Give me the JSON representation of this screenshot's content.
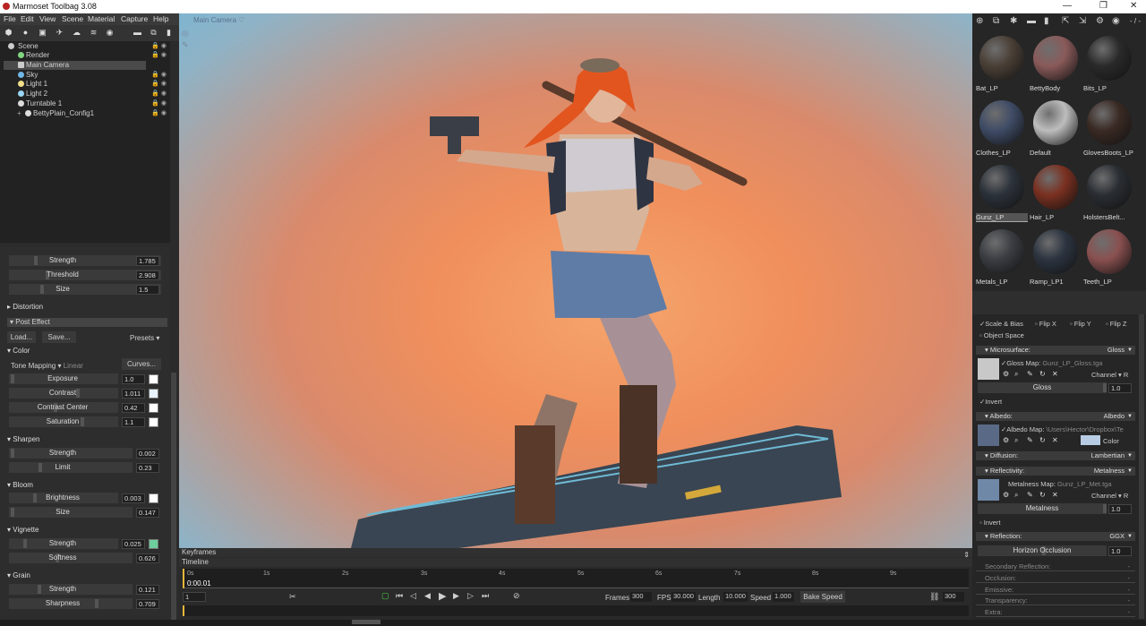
{
  "app": {
    "title": "Marmoset Toolbag 3.08"
  },
  "menu": [
    "File",
    "Edit",
    "View",
    "Scene",
    "Material",
    "Capture",
    "Help"
  ],
  "scene_tree": [
    {
      "label": "Scene",
      "depth": 0,
      "color": "#cccccc"
    },
    {
      "label": "Render",
      "depth": 1,
      "color": "#7fd67f"
    },
    {
      "label": "Main Camera",
      "depth": 1,
      "color": "#cccccc",
      "selected": true
    },
    {
      "label": "Sky",
      "depth": 1,
      "color": "#6fb7e8"
    },
    {
      "label": "Light 1",
      "depth": 1,
      "color": "#f2e08a"
    },
    {
      "label": "Light 2",
      "depth": 1,
      "color": "#9ad4f2"
    },
    {
      "label": "Turntable 1",
      "depth": 1,
      "color": "#dddddd"
    },
    {
      "label": "BettyPlain_Config1",
      "depth": 2,
      "color": "#dddddd"
    }
  ],
  "left_panel": {
    "top_sliders": [
      {
        "label": "Strength",
        "value": "1.785"
      },
      {
        "label": "Threshold",
        "value": "2.908"
      },
      {
        "label": "Size",
        "value": "1.5"
      }
    ],
    "distortion_label": "Distortion",
    "post_effect_label": "Post Effect",
    "load_label": "Load...",
    "save_label": "Save...",
    "presets_label": "Presets",
    "color_label": "Color",
    "tone_mapping_label": "Tone Mapping",
    "tone_mapping_value": "Linear",
    "curves_label": "Curves...",
    "color_sliders": [
      {
        "label": "Exposure",
        "value": "1.0"
      },
      {
        "label": "Contrast",
        "value": "1.011"
      },
      {
        "label": "Contrast Center",
        "value": "0.42"
      },
      {
        "label": "Saturation",
        "value": "1.1"
      }
    ],
    "sharpen_label": "Sharpen",
    "sharpen_sliders": [
      {
        "label": "Strength",
        "value": "0.002"
      },
      {
        "label": "Limit",
        "value": "0.23"
      }
    ],
    "bloom_label": "Bloom",
    "bloom_sliders": [
      {
        "label": "Brightness",
        "value": "0.003"
      },
      {
        "label": "Size",
        "value": "0.147"
      }
    ],
    "vignette_label": "Vignette",
    "vignette_sliders": [
      {
        "label": "Strength",
        "value": "0.025"
      },
      {
        "label": "Softness",
        "value": "0.626"
      }
    ],
    "grain_label": "Grain",
    "grain_sliders": [
      {
        "label": "Strength",
        "value": "0.121"
      },
      {
        "label": "Sharpness",
        "value": "0.709"
      }
    ],
    "vignette_color": "#6ccf9c"
  },
  "viewport": {
    "camera_label": "Main Camera"
  },
  "timeline": {
    "keyframes_label": "Keyframes",
    "timeline_label": "Timeline",
    "current_time": "0:00.01",
    "ticks": [
      "0s",
      "1s",
      "2s",
      "3s",
      "4s",
      "5s",
      "6s",
      "7s",
      "8s",
      "9s"
    ],
    "frame_field": "1",
    "frames_label": "Frames",
    "frames_value": "300",
    "fps_label": "FPS",
    "fps_value": "30.000",
    "length_label": "Length",
    "length_value": "10.000",
    "speed_label": "Speed",
    "speed_value": "1.000",
    "bake_speed_label": "Bake Speed",
    "end_value": "300"
  },
  "materials": [
    {
      "label": "Bat_LP",
      "color": "#4a3f36"
    },
    {
      "label": "BettyBody",
      "color": "#8a5a5a"
    },
    {
      "label": "Bits_LP",
      "color": "#2a2a2a"
    },
    {
      "label": "Clothes_LP",
      "color": "#3f4c66"
    },
    {
      "label": "Default",
      "color": "#bdbdbd"
    },
    {
      "label": "GlovesBoots_LP",
      "color": "#3a2a24"
    },
    {
      "label": "Gunz_LP",
      "color": "#2c323a",
      "selected": true
    },
    {
      "label": "Hair_LP",
      "color": "#7a3020"
    },
    {
      "label": "HolstersBelt...",
      "color": "#2a2e33"
    },
    {
      "label": "Metals_LP",
      "color": "#3a3d42"
    },
    {
      "label": "Ramp_LP1",
      "color": "#2c3440"
    },
    {
      "label": "Teeth_LP",
      "color": "#8a5050"
    }
  ],
  "material_editor": {
    "scale_bias": "Scale & Bias",
    "flip_x": "Flip X",
    "flip_y": "Flip Y",
    "flip_z": "Flip Z",
    "object_space": "Object Space",
    "microsurface": {
      "label": "Microsurface:",
      "mode": "Gloss",
      "map_label": "Gloss Map:",
      "map_file": "Gunz_LP_Gloss.tga",
      "channel_label": "Channel",
      "channel": "R",
      "slider_label": "Gloss",
      "slider_value": "1.0",
      "invert": "Invert"
    },
    "albedo": {
      "label": "Albedo:",
      "mode": "Albedo",
      "map_label": "Albedo Map:",
      "map_file": "\\Users\\Hector\\Dropbox\\Te",
      "color_label": "Color"
    },
    "diffusion": {
      "label": "Diffusion:",
      "mode": "Lambertian"
    },
    "reflectivity": {
      "label": "Reflectivity:",
      "mode": "Metalness",
      "map_label": "Metalness Map:",
      "map_file": "Gunz_LP_Met.tga",
      "channel_label": "Channel",
      "channel": "R",
      "slider_label": "Metalness",
      "slider_value": "1.0",
      "invert": "Invert"
    },
    "reflection": {
      "label": "Reflection:",
      "mode": "GGX",
      "slider_label": "Horizon Occlusion",
      "slider_value": "1.0"
    },
    "collapsed": [
      "Secondary Reflection:",
      "Occlusion:",
      "Emissive:",
      "Transparency:",
      "Extra:"
    ],
    "collapsed_value": "-"
  }
}
